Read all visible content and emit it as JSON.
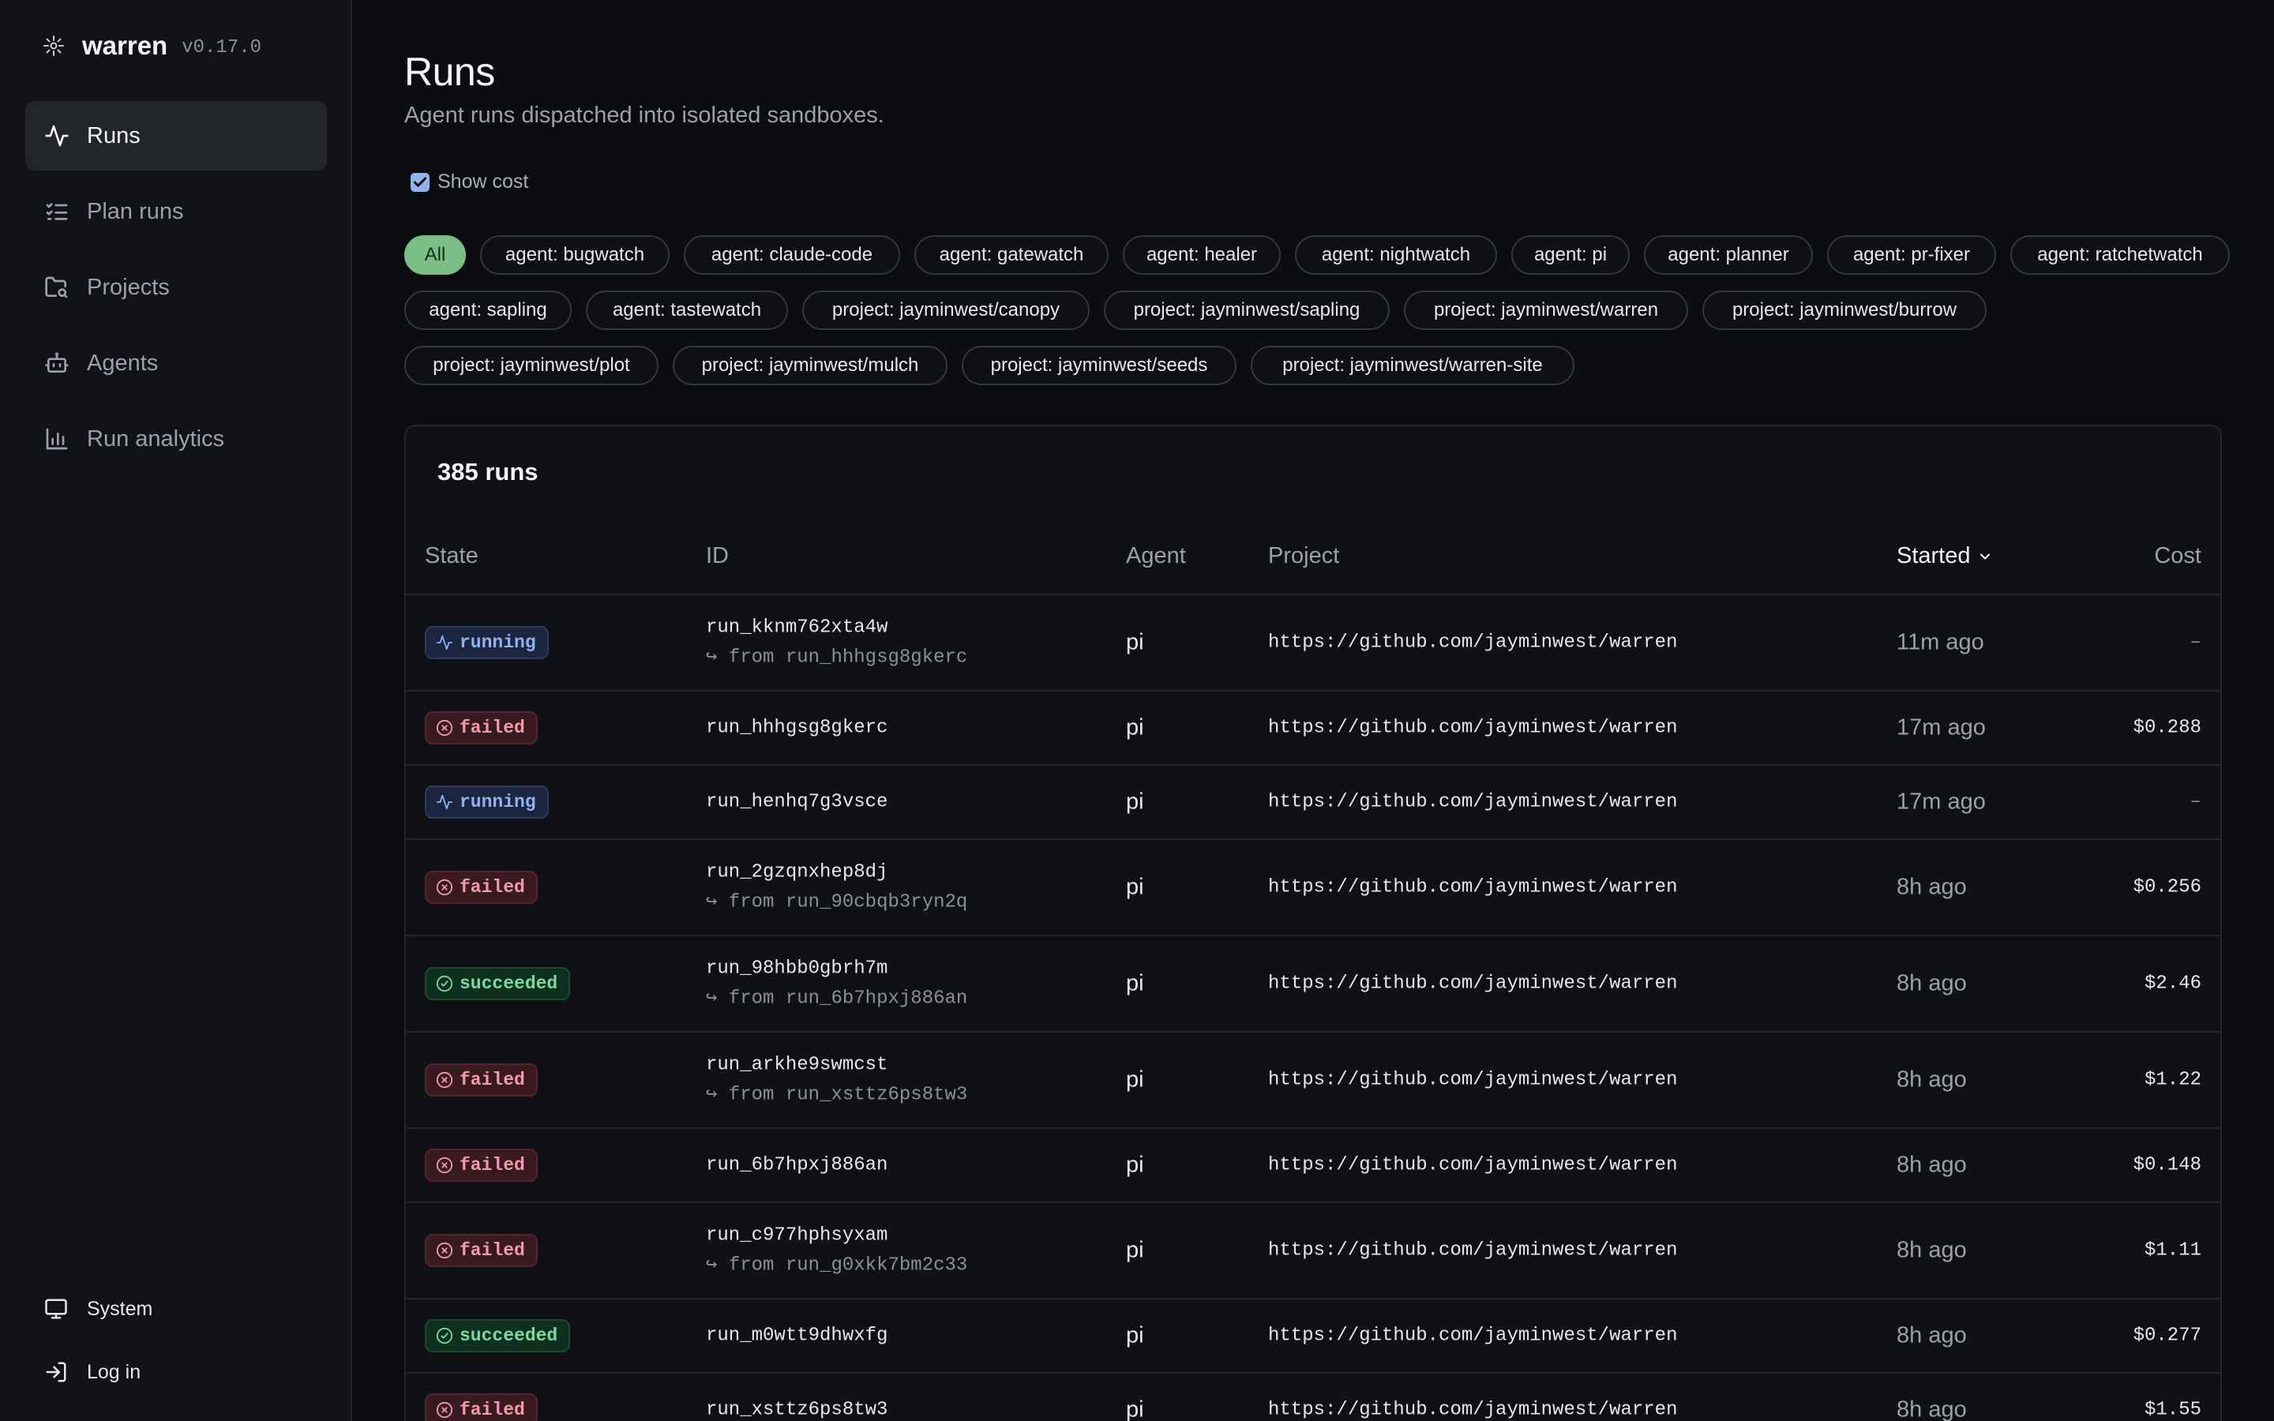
{
  "app": {
    "name": "warren",
    "version": "v0.17.0"
  },
  "nav": [
    {
      "label": "Runs",
      "icon": "activity-icon",
      "active": true
    },
    {
      "label": "Plan runs",
      "icon": "list-checks-icon",
      "active": false
    },
    {
      "label": "Projects",
      "icon": "folder-search-icon",
      "active": false
    },
    {
      "label": "Agents",
      "icon": "bot-icon",
      "active": false
    },
    {
      "label": "Run analytics",
      "icon": "bar-chart-icon",
      "active": false
    }
  ],
  "bottom_nav": {
    "system": "System",
    "login": "Log in"
  },
  "page": {
    "title": "Runs",
    "subtitle": "Agent runs dispatched into isolated sandboxes.",
    "show_cost_label": "Show cost",
    "show_cost_checked": true
  },
  "filters": [
    [
      "All",
      "agent: bugwatch",
      "agent: claude-code",
      "agent: gatewatch",
      "agent: healer",
      "agent: nightwatch",
      "agent: pi",
      "agent: planner",
      "agent: pr-fixer",
      "agent: ratchetwatch"
    ],
    [
      "agent: sapling",
      "agent: tastewatch",
      "project: jayminwest/canopy",
      "project: jayminwest/sapling",
      "project: jayminwest/warren",
      "project: jayminwest/burrow"
    ],
    [
      "project: jayminwest/plot",
      "project: jayminwest/mulch",
      "project: jayminwest/seeds",
      "project: jayminwest/warren-site"
    ]
  ],
  "table": {
    "count_label": "385 runs",
    "headers": {
      "state": "State",
      "id": "ID",
      "agent": "Agent",
      "project": "Project",
      "started": "Started",
      "cost": "Cost"
    },
    "rows": [
      {
        "state": "running",
        "id": "run_kknm762xta4w",
        "from": "↪ from run_hhhgsg8gkerc",
        "agent": "pi",
        "project": "https://github.com/jayminwest/warren",
        "started": "11m ago",
        "cost": "–"
      },
      {
        "state": "failed",
        "id": "run_hhhgsg8gkerc",
        "from": "",
        "agent": "pi",
        "project": "https://github.com/jayminwest/warren",
        "started": "17m ago",
        "cost": "$0.288"
      },
      {
        "state": "running",
        "id": "run_henhq7g3vsce",
        "from": "",
        "agent": "pi",
        "project": "https://github.com/jayminwest/warren",
        "started": "17m ago",
        "cost": "–"
      },
      {
        "state": "failed",
        "id": "run_2gzqnxhep8dj",
        "from": "↪ from run_90cbqb3ryn2q",
        "agent": "pi",
        "project": "https://github.com/jayminwest/warren",
        "started": "8h ago",
        "cost": "$0.256"
      },
      {
        "state": "succeeded",
        "id": "run_98hbb0gbrh7m",
        "from": "↪ from run_6b7hpxj886an",
        "agent": "pi",
        "project": "https://github.com/jayminwest/warren",
        "started": "8h ago",
        "cost": "$2.46"
      },
      {
        "state": "failed",
        "id": "run_arkhe9swmcst",
        "from": "↪ from run_xsttz6ps8tw3",
        "agent": "pi",
        "project": "https://github.com/jayminwest/warren",
        "started": "8h ago",
        "cost": "$1.22"
      },
      {
        "state": "failed",
        "id": "run_6b7hpxj886an",
        "from": "",
        "agent": "pi",
        "project": "https://github.com/jayminwest/warren",
        "started": "8h ago",
        "cost": "$0.148"
      },
      {
        "state": "failed",
        "id": "run_c977hphsyxam",
        "from": "↪ from run_g0xkk7bm2c33",
        "agent": "pi",
        "project": "https://github.com/jayminwest/warren",
        "started": "8h ago",
        "cost": "$1.11"
      },
      {
        "state": "succeeded",
        "id": "run_m0wtt9dhwxfg",
        "from": "",
        "agent": "pi",
        "project": "https://github.com/jayminwest/warren",
        "started": "8h ago",
        "cost": "$0.277"
      },
      {
        "state": "failed",
        "id": "run_xsttz6ps8tw3",
        "from": "",
        "agent": "pi",
        "project": "https://github.com/jayminwest/warren",
        "started": "8h ago",
        "cost": "$1.55"
      }
    ]
  }
}
